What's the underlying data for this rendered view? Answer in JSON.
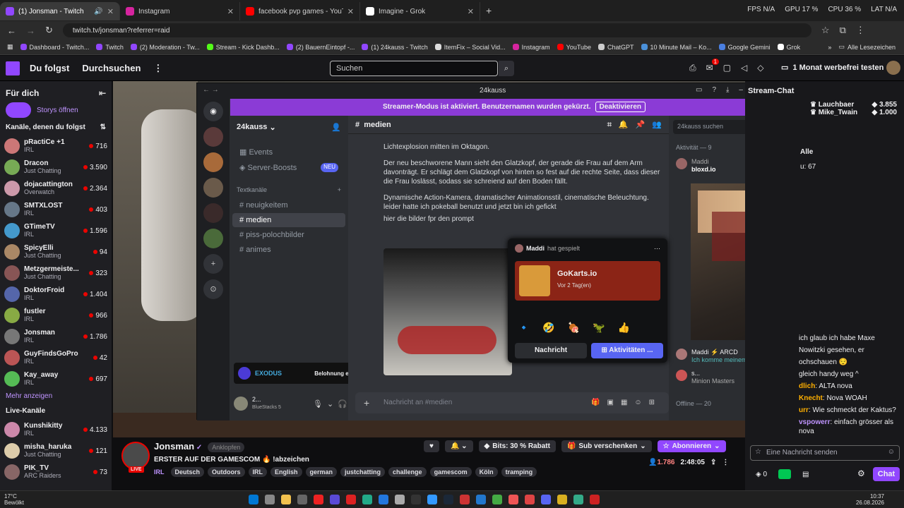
{
  "browser": {
    "tabs": [
      {
        "title": "(1) Jonsman - Twitch",
        "color": "#9147ff",
        "active": true
      },
      {
        "title": "Instagram",
        "color": "#d6249f"
      },
      {
        "title": "facebook pvp games - YouTube",
        "color": "#ff0000"
      },
      {
        "title": "Imagine - Grok",
        "color": "#ffffff"
      }
    ],
    "new_tab": "+",
    "stats": {
      "fps": "FPS N/A",
      "gpu": "GPU 17 %",
      "cpu": "CPU 36 %",
      "lat": "LAT N/A"
    },
    "url": "twitch.tv/jonsman?referrer=raid",
    "bookmarks": [
      "Dashboard - Twitch...",
      "Twitch",
      "(2) Moderation - Tw...",
      "Stream - Kick Dashb...",
      "(2) BauernEintopf -...",
      "(1) 24kauss - Twitch",
      "ItemFix – Social Vid...",
      "Instagram",
      "YouTube",
      "ChatGPT",
      "10 Minute Mail – Ko...",
      "Google Gemini",
      "Grok"
    ],
    "bookmarks_more": "»",
    "bookmarks_all": "Alle Lesezeichen"
  },
  "twitch": {
    "nav": {
      "following": "Du folgst",
      "browse": "Durchsuchen",
      "more": "⋮",
      "search_placeholder": "Suchen",
      "promo": "1 Monat werbefrei testen",
      "notif_count": "1"
    },
    "sidebar": {
      "title": "Für dich",
      "stories": "Storys öffnen",
      "followed_header": "Kanäle, denen du folgst",
      "channels": [
        {
          "name": "pRactiCe +1",
          "game": "IRL",
          "viewers": "716",
          "color": "#c77"
        },
        {
          "name": "Dracon",
          "game": "Just Chatting",
          "viewers": "3.590",
          "color": "#7a5"
        },
        {
          "name": "dojacattington",
          "game": "Overwatch",
          "viewers": "2.364",
          "color": "#c9a"
        },
        {
          "name": "SMTXLOST",
          "game": "IRL",
          "viewers": "403",
          "color": "#678"
        },
        {
          "name": "GTimeTV",
          "game": "IRL",
          "viewers": "1.596",
          "color": "#49c"
        },
        {
          "name": "SpicyElli",
          "game": "Just Chatting",
          "viewers": "94",
          "color": "#a86"
        },
        {
          "name": "Metzgermeiste...",
          "game": "Just Chatting",
          "viewers": "323",
          "color": "#855"
        },
        {
          "name": "DoktorFroid",
          "game": "IRL",
          "viewers": "1.404",
          "color": "#56a"
        },
        {
          "name": "fustler",
          "game": "IRL",
          "viewers": "966",
          "color": "#8a4"
        },
        {
          "name": "Jonsman",
          "game": "IRL",
          "viewers": "1.786",
          "color": "#777"
        },
        {
          "name": "GuyFindsGoPro",
          "game": "IRL",
          "viewers": "42",
          "color": "#b55"
        },
        {
          "name": "Kay_away",
          "game": "IRL",
          "viewers": "697",
          "color": "#5b5"
        }
      ],
      "show_more": "Mehr anzeigen",
      "live_header": "Live-Kanäle",
      "live_channels": [
        {
          "name": "Kunshikitty",
          "game": "IRL",
          "viewers": "4.133",
          "color": "#c8a"
        },
        {
          "name": "misha_haruka",
          "game": "Just Chatting",
          "viewers": "121",
          "color": "#dca"
        },
        {
          "name": "PIK_TV",
          "game": "ARC Raiders",
          "viewers": "73",
          "color": "#866"
        }
      ]
    },
    "stream": {
      "channel": "Jonsman",
      "title": "ERSTER AUF DER GAMESCOM 🔥 !abzeichen",
      "category": "IRL",
      "tags": [
        "Deutsch",
        "Outdoors",
        "IRL",
        "English",
        "german",
        "justchatting",
        "challenge",
        "gamescom",
        "Köln",
        "tramping"
      ],
      "live": "LIVE",
      "viewers": "1.786",
      "uptime": "2:48:05",
      "pin": "Anklopfen",
      "bits": "Bits: 30 % Rabatt",
      "gift": "Sub verschenken",
      "subscribe": "Abonnieren"
    },
    "chat": {
      "header": "Stream-Chat",
      "top": [
        {
          "name": "Lauchbaer",
          "score": "3.855"
        },
        {
          "name": "Mike_Twain",
          "score": "1.000"
        }
      ],
      "partial": [
        "Alle",
        "u: 67"
      ],
      "lines": [
        {
          "user": "",
          "text": "ich glaub ich habe Maxe"
        },
        {
          "user": "",
          "text": "Nowitzki gesehen, er"
        },
        {
          "user": "",
          "text": "ochschauen 😌"
        },
        {
          "user": "",
          "text": "gleich handy weg ^"
        },
        {
          "user": "dlich",
          "text": ": ALTA nova",
          "color": "#ffb000"
        },
        {
          "user": "Knecht",
          "text": ": Nova WOAH",
          "color": "#ffb000"
        },
        {
          "user": "urr",
          "text": ": Wie schmeckt der Kaktus?",
          "color": "#ffb000"
        },
        {
          "user": "vspowerr",
          "text": ": einfach grösser als nova",
          "color": "#bf94ff"
        }
      ],
      "input_placeholder": "Eine Nachricht senden",
      "points": "0",
      "send": "Chat"
    }
  },
  "discord": {
    "window_title": "24kauss",
    "banner": "Streamer-Modus ist aktiviert. Benutzernamen wurden gekürzt.",
    "banner_btn": "Deaktivieren",
    "server_name": "24kauss",
    "events": "Events",
    "boosts": "Server-Boosts",
    "new_badge": "NEU",
    "text_channels": "Textkanäle",
    "channels": [
      "neuigkeitem",
      "medien",
      "piss-polochbilder",
      "animes"
    ],
    "active_channel": "medien",
    "search_placeholder": "24kauss suchen",
    "activity_header": "Aktivität — 9",
    "messages": [
      "Lichtexplosion mitten im Oktagon.",
      "Der neu beschworene Mann sieht den Glatzkopf, der gerade die Frau auf dem Arm davonträgt. Er schlägt dem Glatzkopf von hinten so fest auf die rechte Seite, dass dieser die Frau loslässt, sodass sie schreiend auf den Boden fällt.",
      "Dynamische Action-Kamera, dramatischer Animationsstil, cinematische Beleuchtung.",
      "leider hatte ich pokeball benutzt und jetzt bin ich gefickt",
      "hier die bilder fpr den prompt"
    ],
    "composer_placeholder": "Nachricht an #medien",
    "exodus": "Belohnung erhalten!",
    "exodus_logo": "EXODUS",
    "user_name": "2...",
    "user_status": "BlueStacks 5",
    "popup": {
      "user": "Maddi",
      "action": "hat gespielt",
      "game": "GoKarts.io",
      "time": "Vor 2 Tag(en)",
      "btn_message": "Nachricht",
      "btn_activities": "Aktivitäten ..."
    },
    "members": [
      {
        "name": "Maddi",
        "sub": "bloxd.io"
      },
      {
        "name": "Maddi ⚡ ARCD",
        "sub": "Ich komme meinem Jarvis im..."
      },
      {
        "name": "s...",
        "sub": "Minion Masters"
      }
    ],
    "offline": "Offline — 20"
  },
  "taskbar": {
    "weather": "17°C",
    "weather_sub": "Bewölkt",
    "time": "10:37",
    "date": "26.08.2026"
  }
}
